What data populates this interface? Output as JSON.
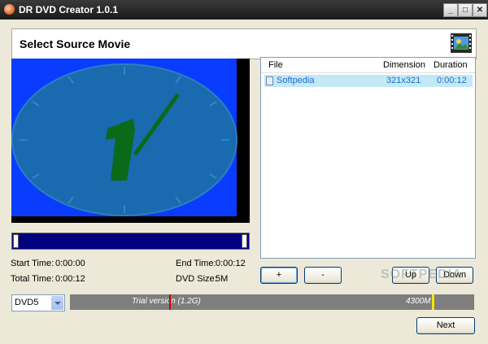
{
  "window": {
    "title": "DR DVD Creator 1.0.1",
    "controls": [
      "_",
      "□",
      "✕"
    ]
  },
  "header": {
    "title": "Select Source Movie"
  },
  "preview": {
    "colors": {
      "background": "#0a3cff",
      "clock": "#1a6ab0",
      "hand": "#0b6a1a"
    }
  },
  "times": {
    "start_label": "Start Time:",
    "start_value": "0:00:00",
    "end_label": "End Time:",
    "end_value": "0:00:12",
    "total_label": "Total Time:",
    "total_value": "0:00:12",
    "size_label": "DVD Size:",
    "size_value": "5M"
  },
  "file_list": {
    "columns": [
      "File",
      "Dimension",
      "Duration"
    ],
    "rows": [
      {
        "file": "Softpedia",
        "dimension": "321x321",
        "duration": "0:00:12"
      }
    ]
  },
  "buttons": {
    "add": "+",
    "remove": "-",
    "up": "Up",
    "down": "Down",
    "next": "Next"
  },
  "disc": {
    "selected": "DVD5",
    "trial_label": "Trial version (1.2G)",
    "capacity_label": "4300M"
  },
  "watermark": "SOFTPEDIA"
}
